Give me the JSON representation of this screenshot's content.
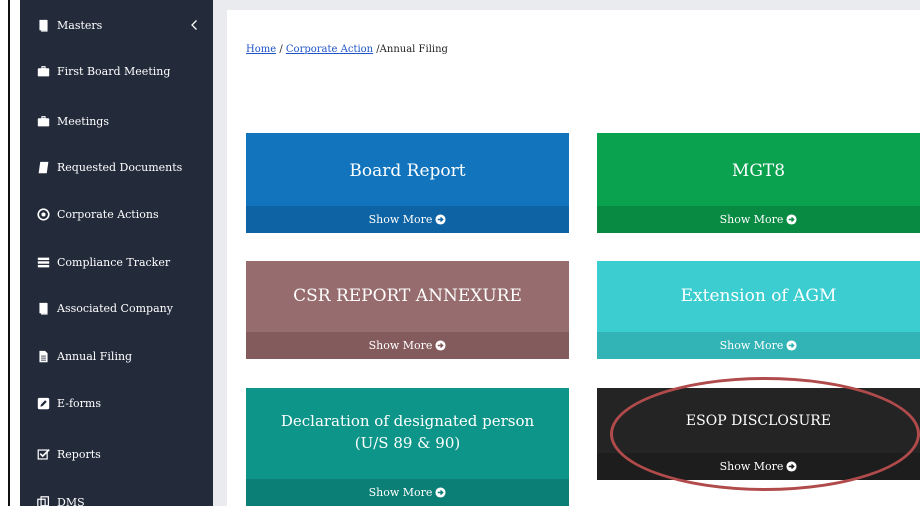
{
  "sidebar": {
    "items": [
      {
        "label": "Masters",
        "icon": "book-icon"
      },
      {
        "label": "First Board Meeting",
        "icon": "briefcase-icon"
      },
      {
        "label": "Meetings",
        "icon": "briefcase-icon"
      },
      {
        "label": "Requested Documents",
        "icon": "book-icon"
      },
      {
        "label": "Corporate Actions",
        "icon": "circle-dot-icon"
      },
      {
        "label": "Compliance Tracker",
        "icon": "list-icon"
      },
      {
        "label": "Associated Company",
        "icon": "book-icon"
      },
      {
        "label": "Annual Filing",
        "icon": "file-icon"
      },
      {
        "label": "E-forms",
        "icon": "edit-icon"
      },
      {
        "label": "Reports",
        "icon": "check-square-icon"
      },
      {
        "label": "DMS",
        "icon": "copy-icon"
      }
    ]
  },
  "breadcrumb": {
    "home": "Home",
    "sep1": " / ",
    "corporate_action": "Corporate Action",
    "current": " /Annual Filing"
  },
  "cards": [
    {
      "title": "Board Report",
      "more": "Show More",
      "color": "#1174bd"
    },
    {
      "title": "MGT8",
      "more": "Show More",
      "color": "#0aa14f"
    },
    {
      "title": "CSR REPORT ANNEXURE",
      "more": "Show More",
      "color": "#966c6e"
    },
    {
      "title": "Extension of AGM",
      "more": "Show More",
      "color": "#3bcdcf"
    },
    {
      "title_line1": "Declaration of designated person",
      "title_line2": "(U/S 89 & 90)",
      "more": "Show More",
      "color": "#0d9589"
    },
    {
      "title": "ESOP DISCLOSURE",
      "more": "Show More",
      "color": "#242424"
    }
  ],
  "colors": {
    "sidebar_bg": "#232b3b",
    "link": "#1f55c8",
    "highlight_ring": "#b14b4b"
  }
}
